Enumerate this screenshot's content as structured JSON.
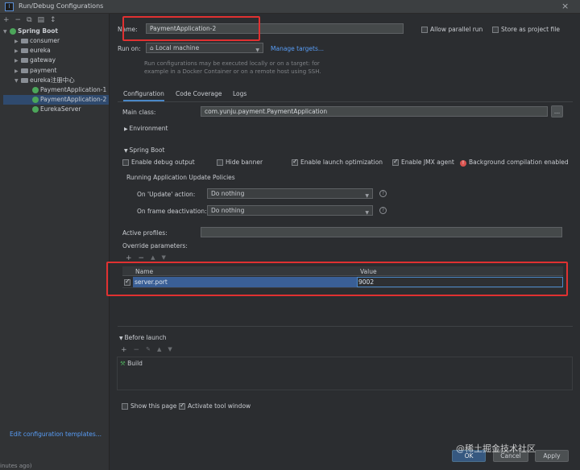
{
  "window": {
    "title": "Run/Debug Configurations",
    "close": "×"
  },
  "toolbar": {
    "icons": [
      "+",
      "−",
      "⧉",
      "▤",
      "↕"
    ]
  },
  "tree": {
    "root": "Spring Boot",
    "items": [
      "consumer",
      "eureka",
      "gateway",
      "payment",
      "eureka注册中心"
    ],
    "configs": [
      "PaymentApplication-1",
      "PaymentApplication-2",
      "EurekaServer"
    ],
    "edit_templates": "Edit configuration templates..."
  },
  "form": {
    "name_label": "Name:",
    "name_value": "PaymentApplication-2",
    "allow_parallel": "Allow parallel run",
    "store_as_project": "Store as project file",
    "run_on_label": "Run on:",
    "run_on_value": "Local machine",
    "manage_targets": "Manage targets...",
    "hint_line1": "Run configurations may be executed locally or on a target: for",
    "hint_line2": "example in a Docker Container or on a remote host using SSH."
  },
  "tabs": [
    "Configuration",
    "Code Coverage",
    "Logs"
  ],
  "config": {
    "main_class_label": "Main class:",
    "main_class_value": "com.yunju.payment.PaymentApplication",
    "browse": "...",
    "environment": "Environment",
    "spring_boot": "Spring Boot",
    "enable_debug": "Enable debug output",
    "hide_banner": "Hide banner",
    "enable_launch_opt": "Enable launch optimization",
    "enable_jmx": "Enable JMX agent",
    "bg_compile": "Background compilation enabled",
    "policies_title": "Running Application Update Policies",
    "on_update_label": "On 'Update' action:",
    "on_update_value": "Do nothing",
    "on_frame_label": "On frame deactivation:",
    "on_frame_value": "Do nothing",
    "active_profiles": "Active profiles:",
    "override_params": "Override parameters:",
    "table_toolbar": [
      "+",
      "−",
      "▲",
      "▼"
    ],
    "col_name": "Name",
    "col_value": "Value",
    "row_name": "server.port",
    "row_value": "9002"
  },
  "before_launch": {
    "title": "Before launch",
    "toolbar": [
      "+",
      "−",
      "✎",
      "▲",
      "▼"
    ],
    "task": "Build"
  },
  "footer": {
    "show_page": "Show this page",
    "activate_tool": "Activate tool window",
    "ok": "OK",
    "cancel": "Cancel",
    "apply": "Apply",
    "watermark": "@稀土掘金技术社区",
    "bottom_left": "inutes ago)"
  },
  "colors": {
    "accent": "#4a88c7",
    "highlight": "#e03131",
    "selection": "#2f4a6e"
  }
}
